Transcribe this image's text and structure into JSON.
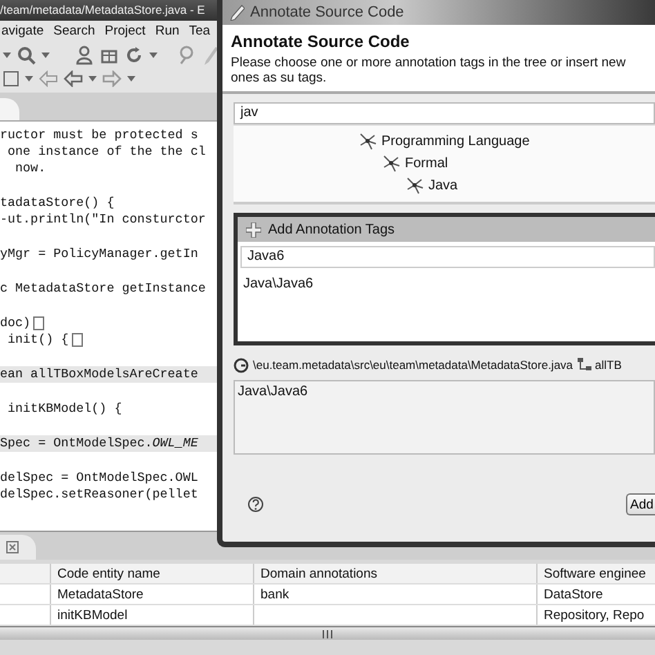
{
  "window": {
    "title": "/team/metadata/MetadataStore.java - E"
  },
  "menu": [
    "avigate",
    "Search",
    "Project",
    "Run",
    "Tea"
  ],
  "code_blocks": [
    [
      {
        "text": "ructor must be protected s",
        "highlighted": false,
        "folded": false
      },
      {
        "text": " one instance of the the cl",
        "highlighted": false,
        "folded": false
      },
      {
        "text": "  now.",
        "highlighted": false,
        "folded": false
      }
    ],
    [
      {
        "text": "tadataStore() {",
        "highlighted": false,
        "folded": false
      },
      {
        "text": "-ut.println(\"In consturctor",
        "highlighted": false,
        "folded": false
      }
    ],
    [
      {
        "text": "yMgr = PolicyManager.getIn",
        "highlighted": false,
        "folded": false
      }
    ],
    [
      {
        "text": "c MetadataStore getInstance",
        "highlighted": false,
        "folded": false
      }
    ],
    [
      {
        "text": "doc)",
        "highlighted": false,
        "folded": true
      },
      {
        "text": " init() {",
        "highlighted": false,
        "folded": true
      }
    ],
    [
      {
        "text": "ean allTBoxModelsAreCreate",
        "highlighted": true,
        "folded": false
      }
    ],
    [
      {
        "text": " initKBModel() {",
        "highlighted": false,
        "folded": false
      }
    ],
    [
      {
        "text": "Spec = OntModelSpec.*OWL_ME*",
        "highlighted": true,
        "folded": false
      }
    ],
    [
      {
        "text": "delSpec = OntModelSpec.OWL",
        "highlighted": false,
        "folded": false
      },
      {
        "text": "delSpec.setReasoner(pellet",
        "highlighted": false,
        "folded": false
      }
    ]
  ],
  "dialog": {
    "title": "Annotate Source Code",
    "heading": "Annotate Source Code",
    "description": "Please choose one or more annotation tags in the tree or insert new ones as su tags.",
    "search": {
      "value": "jav"
    },
    "tree": [
      {
        "label": "Programming Language",
        "children": [
          {
            "label": "Formal",
            "children": [
              {
                "label": "Java"
              }
            ]
          }
        ]
      }
    ],
    "add_section": {
      "title": "Add Annotation Tags",
      "field": {
        "value": "Java6"
      },
      "items": [
        "Java\\Java6"
      ]
    },
    "location": {
      "path": "\\eu.team.metadata\\src\\eu\\team\\metadata\\MetadataStore.java",
      "member": "allTB"
    },
    "selected_tags": "Java\\Java6",
    "buttons": [
      "Add"
    ]
  },
  "table": {
    "columns": [
      "Code entity name",
      "Domain annotations",
      "Software enginee"
    ],
    "rows": [
      [
        "MetadataStore",
        "bank",
        "DataStore"
      ],
      [
        "initKBModel",
        "",
        "Repository, Repo"
      ]
    ]
  }
}
